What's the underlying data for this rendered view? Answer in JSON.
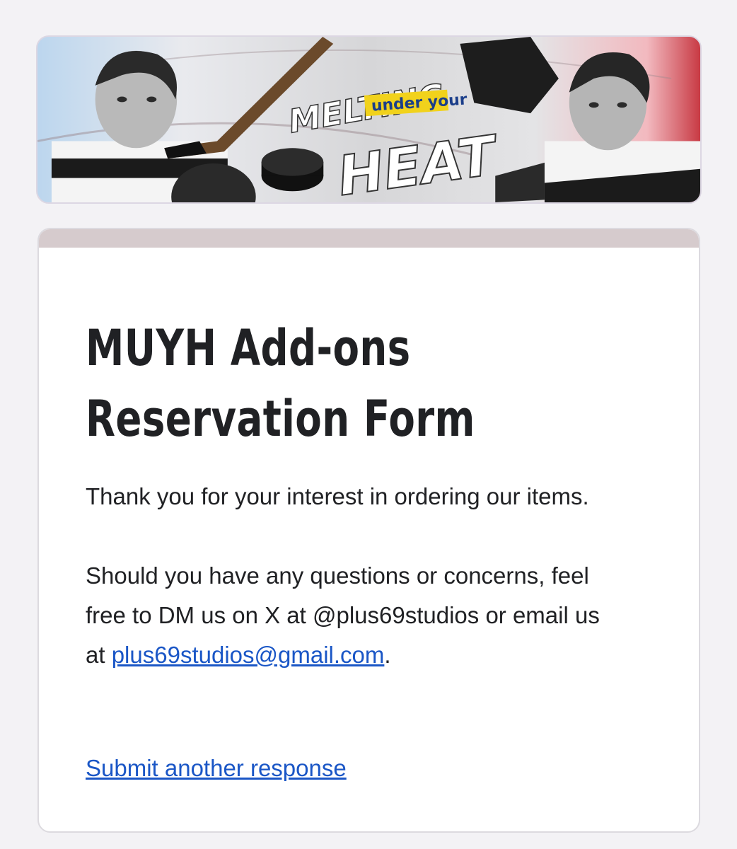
{
  "banner": {
    "title_line1": "MELTING",
    "title_accent": "under your",
    "title_line2": "HEAT"
  },
  "form": {
    "title_line1": "MUYH Add-ons",
    "title_line2": "Reservation Form",
    "message_line1": "Thank you for your interest in ordering our items.",
    "message_line2_prefix": "Should you have any questions or concerns, feel free to DM us on X at @plus69studios or email us at ",
    "email": "plus69studios@gmail.com",
    "message_line2_suffix": ".",
    "submit_another": "Submit another response"
  },
  "colors": {
    "card_accent": "#d6cbcd",
    "link": "#1a56c6",
    "background": "#f3f2f5"
  }
}
